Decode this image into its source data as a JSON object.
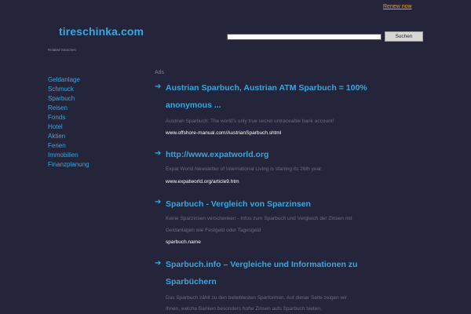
{
  "header": {
    "renew_label": "Renew now",
    "logo_text": "tireschinka.com",
    "search": {
      "value": "",
      "placeholder": "",
      "button_label": "Suchen"
    }
  },
  "sidebar": {
    "heading": "Related Searches",
    "items": [
      {
        "label": "Geldanlage"
      },
      {
        "label": "Schmuck"
      },
      {
        "label": "Sparbuch"
      },
      {
        "label": "Reisen"
      },
      {
        "label": "Fonds"
      },
      {
        "label": "Hotel"
      },
      {
        "label": "Aktien"
      },
      {
        "label": "Ferien"
      },
      {
        "label": "Immobilien"
      },
      {
        "label": "Finanzplanung"
      }
    ]
  },
  "main": {
    "ads_label": "Ads",
    "ads": [
      {
        "title_line1": "Austrian Sparbuch, Austrian ATM Sparbuch = 100%",
        "title_line2": "anonymous ...",
        "desc_line1": "Austrian Sparbuch: The world's only true secret untraceable bank account!",
        "desc_line2": "",
        "url": "www.offshore-manual.com/AustrianSparbuch.shtml"
      },
      {
        "title_line1": "http://www.expatworld.org",
        "title_line2": "",
        "desc_line1": "Expat World Newsletter of International Living is starting its 26th year.",
        "desc_line2": "",
        "url": "www.expatworld.org/article9.htm"
      },
      {
        "title_line1": "Sparbuch - Vergleich von Sparzinsen",
        "title_line2": "",
        "desc_line1": "Keine Sparzinsen verschenken - Infos zum Sparbuch und Vergleich der Zinsen mit",
        "desc_line2": "Geldanlagen wie Festgeld oder Tagesgeld",
        "url": "sparbuch.name"
      },
      {
        "title_line1": "Sparbuch.info – Vergleiche und Informationen zu",
        "title_line2": "Sparbüchern",
        "desc_line1": "Das Sparbuch zählt zu den beliebtesten Sparformen. Auf dieser Seite zeigen wir",
        "desc_line2": "Ihnen, welche Banken besonders hohe Zinsen aufs Sparbuch bieten.",
        "url": ""
      }
    ]
  },
  "colors": {
    "background": "#24253a",
    "link": "#3aa6dd",
    "renew": "#f0a01e",
    "muted_text": "#6b6d7d"
  },
  "icons": {
    "ad_arrow": "arrow-right-icon"
  }
}
